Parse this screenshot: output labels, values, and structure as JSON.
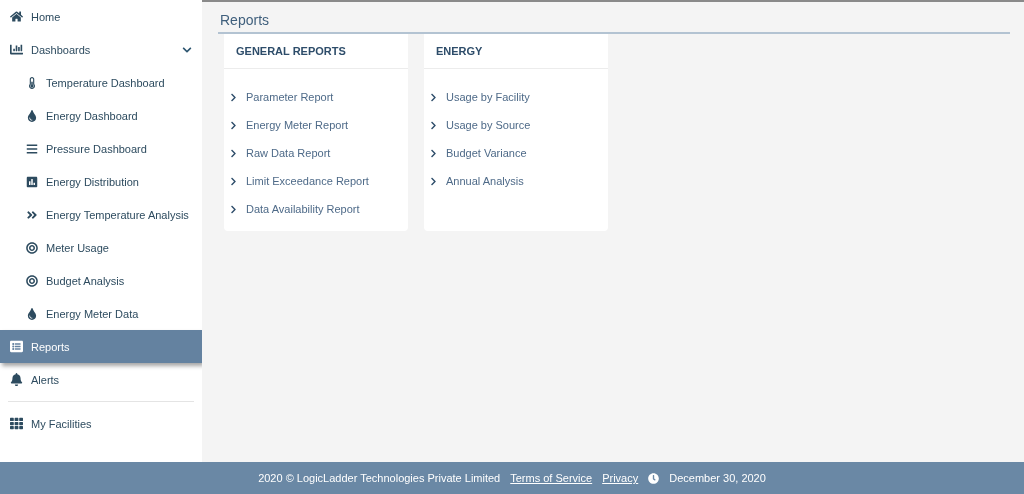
{
  "sidebar": {
    "items": [
      {
        "label": "Home",
        "selected": false
      },
      {
        "label": "Dashboards",
        "selected": false,
        "expanded": true,
        "children": [
          {
            "label": "Temperature Dashboard",
            "selected": false
          },
          {
            "label": "Energy Dashboard",
            "selected": false
          },
          {
            "label": "Pressure Dashboard",
            "selected": false
          },
          {
            "label": "Energy Distribution",
            "selected": false
          },
          {
            "label": "Energy Temperature Analysis",
            "selected": false
          },
          {
            "label": "Meter Usage",
            "selected": false
          },
          {
            "label": "Budget Analysis",
            "selected": false
          },
          {
            "label": "Energy Meter Data",
            "selected": false
          }
        ]
      },
      {
        "label": "Reports",
        "selected": true
      },
      {
        "label": "Alerts",
        "selected": false
      },
      {
        "label": "My Facilities",
        "selected": false
      }
    ]
  },
  "page_title": "Reports",
  "cards": [
    {
      "title": "GENERAL REPORTS",
      "links": [
        "Parameter Report",
        "Energy Meter Report",
        "Raw Data Report",
        "Limit Exceedance Report",
        "Data Availability Report"
      ]
    },
    {
      "title": "ENERGY",
      "links": [
        "Usage by Facility",
        "Usage by Source",
        "Budget Variance",
        "Annual Analysis"
      ]
    }
  ],
  "footer": {
    "copyright": "2020 © LogicLadder Technologies Private Limited",
    "links": [
      "Terms of Service",
      "Privacy"
    ],
    "date": "December 30, 2020"
  }
}
